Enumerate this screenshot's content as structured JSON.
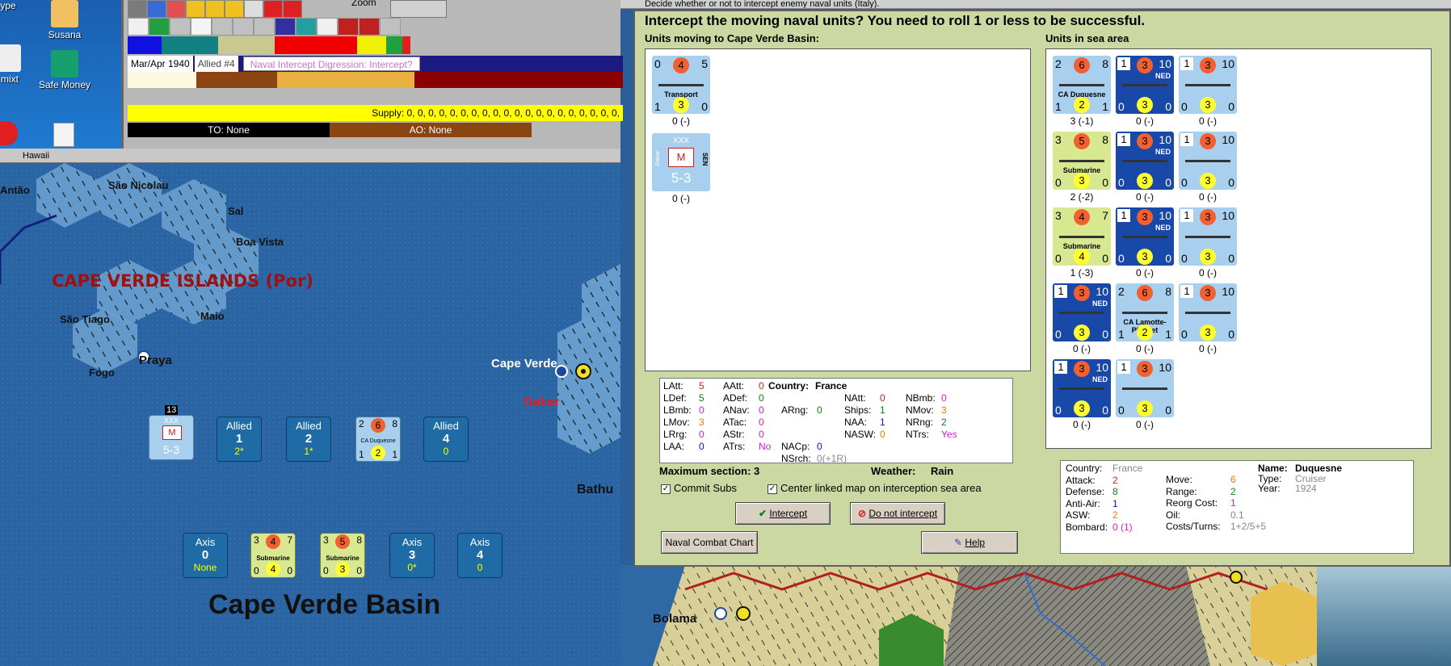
{
  "desktop": {
    "icons": [
      {
        "label": "ype"
      },
      {
        "label": "Susana"
      },
      {
        "label": "mixt"
      },
      {
        "label": "Safe Money"
      }
    ]
  },
  "top_panel": {
    "zoom_label": "Zoom",
    "date": "Mar/Apr 1940",
    "side": "Allied #4",
    "phase": "Naval Intercept Digression: Intercept?",
    "supply": "Supply: 0, 0, 0, 0, 0, 0, 0, 0, 0, 0, 0, 0, 0, 0, 0, 0, 0, 0, 0, 0,",
    "to": "TO: None",
    "ao": "AO: None"
  },
  "map": {
    "window_title": "Hawaii",
    "region_title": "CAPE VERDE ISLANDS (Por)",
    "sea_area_title": "Cape Verde Basin",
    "places": [
      "Antão",
      "São Nicolau",
      "Sal",
      "Boa Vista",
      "São Tiago",
      "Maio",
      "Praya",
      "Fogo",
      "Cape Verde",
      "Dakar",
      "Bathu",
      "Bolama"
    ],
    "stack_count": "13",
    "boxes": [
      {
        "title": "Allied",
        "num": "1",
        "sub": "2*"
      },
      {
        "title": "Allied",
        "num": "2",
        "sub": "1*"
      },
      {
        "title": "Allied",
        "num": "4",
        "sub": "0"
      },
      {
        "title": "Axis",
        "num": "0",
        "sub": "None"
      },
      {
        "title": "Axis",
        "num": "3",
        "sub": "0*"
      },
      {
        "title": "Axis",
        "num": "4",
        "sub": "0"
      }
    ],
    "map_counters": [
      {
        "tl": "2",
        "tm": "6",
        "tr": "8",
        "name": "CA Duquesne",
        "bl": "1",
        "bm": "2",
        "br": "1"
      },
      {
        "tl": "3",
        "tm": "4",
        "tr": "7",
        "name": "Submarine",
        "bl": "0",
        "bm": "4",
        "br": "0"
      },
      {
        "tl": "3",
        "tm": "5",
        "tr": "8",
        "name": "Submarine",
        "bl": "0",
        "bm": "3",
        "br": "0"
      }
    ],
    "army_counter": {
      "corps": "XXX",
      "strength": "5-3",
      "nation": "SEN",
      "city": "Dakar"
    }
  },
  "dialog": {
    "window_title": "Decide whether or not to intercept enemy naval units (Italy).",
    "heading": "Intercept the moving naval units?  You need to roll 1 or less to be successful.",
    "moving_header": "Units moving to Cape Verde Basin:",
    "sea_header": "Units in sea area",
    "moving_units": [
      {
        "tl": "0",
        "tm": "4",
        "tr": "5",
        "name": "Transport",
        "bl": "1",
        "bm": "3",
        "br": "0",
        "caption": "0 (-)",
        "color": "lb"
      },
      {
        "corps": "XXX",
        "strength": "5-3",
        "nation": "SEN",
        "city": "Dakar",
        "caption": "0 (-)",
        "color": "lb"
      }
    ],
    "sea_units": [
      {
        "tl": "2",
        "tm": "6",
        "tr": "8",
        "name": "CA Duquesne",
        "bl": "1",
        "bm": "2",
        "br": "1",
        "caption": "3 (-1)",
        "color": "lb"
      },
      {
        "tl": "1",
        "tm": "3",
        "tr": "10",
        "name": "",
        "bl": "0",
        "bm": "3",
        "br": "0",
        "caption": "0 (-)",
        "color": "blue",
        "tag": "NED"
      },
      {
        "tl": "1",
        "tm": "3",
        "tr": "10",
        "name": "",
        "bl": "0",
        "bm": "3",
        "br": "0",
        "caption": "0 (-)",
        "color": "lb"
      },
      {
        "tl": "3",
        "tm": "5",
        "tr": "8",
        "name": "Submarine",
        "bl": "0",
        "bm": "3",
        "br": "0",
        "caption": "2 (-2)",
        "color": "lime"
      },
      {
        "tl": "1",
        "tm": "3",
        "tr": "10",
        "name": "",
        "bl": "0",
        "bm": "3",
        "br": "0",
        "caption": "0 (-)",
        "color": "blue",
        "tag": "NED"
      },
      {
        "tl": "1",
        "tm": "3",
        "tr": "10",
        "name": "",
        "bl": "0",
        "bm": "3",
        "br": "0",
        "caption": "0 (-)",
        "color": "lb"
      },
      {
        "tl": "3",
        "tm": "4",
        "tr": "7",
        "name": "Submarine",
        "bl": "0",
        "bm": "4",
        "br": "0",
        "caption": "1 (-3)",
        "color": "lime"
      },
      {
        "tl": "1",
        "tm": "3",
        "tr": "10",
        "name": "",
        "bl": "0",
        "bm": "3",
        "br": "0",
        "caption": "0 (-)",
        "color": "blue",
        "tag": "NED"
      },
      {
        "tl": "1",
        "tm": "3",
        "tr": "10",
        "name": "",
        "bl": "0",
        "bm": "3",
        "br": "0",
        "caption": "0 (-)",
        "color": "lb"
      },
      {
        "tl": "1",
        "tm": "3",
        "tr": "10",
        "name": "",
        "bl": "0",
        "bm": "3",
        "br": "0",
        "caption": "0 (-)",
        "color": "blue",
        "tag": "NED"
      },
      {
        "tl": "2",
        "tm": "6",
        "tr": "8",
        "name": "CA Lamotte-Picquet",
        "bl": "1",
        "bm": "2",
        "br": "1",
        "caption": "0 (-)",
        "color": "lb"
      },
      {
        "tl": "1",
        "tm": "3",
        "tr": "10",
        "name": "",
        "bl": "0",
        "bm": "3",
        "br": "0",
        "caption": "0 (-)",
        "color": "lb"
      },
      {
        "tl": "1",
        "tm": "3",
        "tr": "10",
        "name": "",
        "bl": "0",
        "bm": "3",
        "br": "0",
        "caption": "0 (-)",
        "color": "blue",
        "tag": "NED"
      },
      {
        "tl": "1",
        "tm": "3",
        "tr": "10",
        "name": "",
        "bl": "0",
        "bm": "3",
        "br": "0",
        "caption": "0 (-)",
        "color": "lb"
      }
    ],
    "stats": {
      "country_label": "Country:",
      "country": "France",
      "col1": [
        [
          "LAtt:",
          "5",
          "red"
        ],
        [
          "LDef:",
          "5",
          "green"
        ],
        [
          "LBmb:",
          "0",
          "mag"
        ],
        [
          "LMov:",
          "3",
          "ora"
        ],
        [
          "LRrg:",
          "0",
          "mag"
        ],
        [
          "LAA:",
          "0",
          "blue"
        ]
      ],
      "col2": [
        [
          "AAtt:",
          "0",
          "red"
        ],
        [
          "ADef:",
          "0",
          "green"
        ],
        [
          "ANav:",
          "0",
          "mag"
        ],
        [
          "ATac:",
          "0",
          "mag"
        ],
        [
          "AStr:",
          "0",
          "mag"
        ],
        [
          "ATrs:",
          "No",
          "mag"
        ]
      ],
      "arng": [
        "ARng:",
        "0",
        "green"
      ],
      "nacp": [
        "NACp:",
        "0",
        "blue"
      ],
      "nsrch": [
        "NSrch:",
        "0(+1R)",
        "grey"
      ],
      "col3": [
        [
          "NAtt:",
          "0",
          "red"
        ],
        [
          "Ships:",
          "1",
          "green"
        ],
        [
          "NAA:",
          "1",
          "blue"
        ],
        [
          "NASW:",
          "0",
          "ora"
        ]
      ],
      "col4": [
        [
          "NBmb:",
          "0",
          "mag"
        ],
        [
          "NMov:",
          "3",
          "ora"
        ],
        [
          "NRng:",
          "2",
          "green"
        ],
        [
          "NTrs:",
          "Yes",
          "mag"
        ]
      ]
    },
    "max_section_label": "Maximum section: 3",
    "weather_label": "Weather:",
    "weather": "Rain",
    "commit_subs": "Commit Subs",
    "center_map": "Center linked map on interception sea area",
    "intercept_btn": "Intercept",
    "no_intercept_btn": "Do not intercept",
    "chart_btn": "Naval Combat Chart",
    "help_btn": "Help",
    "details": {
      "left": [
        [
          "Country:",
          "France",
          "grey"
        ],
        [
          "Attack:",
          "2",
          "red"
        ],
        [
          "Defense:",
          "8",
          "green"
        ],
        [
          "Anti-Air:",
          "1",
          "blue"
        ],
        [
          "ASW:",
          "2",
          "ora"
        ],
        [
          "Bombard:",
          "0 (1)",
          "mag"
        ]
      ],
      "mid": [
        [
          "Move:",
          "6",
          "ora"
        ],
        [
          "Range:",
          "2",
          "green"
        ],
        [
          "Reorg Cost:",
          "1",
          "mag"
        ],
        [
          "Oil:",
          "0.1",
          "grey"
        ],
        [
          "Costs/Turns:",
          "1+2/5+5",
          "grey"
        ]
      ],
      "right": [
        [
          "Name:",
          "Duquesne"
        ],
        [
          "Type:",
          "Cruiser"
        ],
        [
          "Year:",
          "1924"
        ]
      ]
    }
  }
}
